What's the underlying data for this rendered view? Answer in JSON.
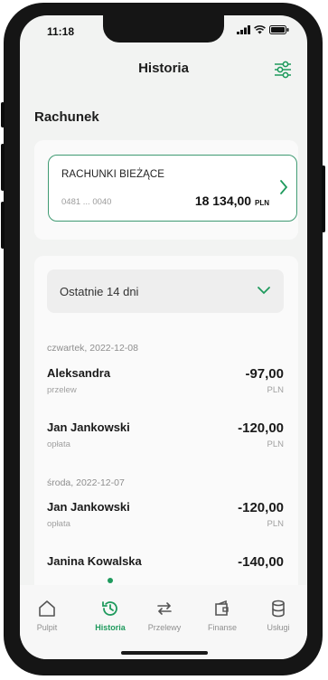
{
  "status_bar": {
    "time": "11:18"
  },
  "header": {
    "title": "Historia",
    "filter_icon": "sliders-icon"
  },
  "section": {
    "label": "Rachunek"
  },
  "account": {
    "name": "RACHUNKI BIEŻĄCE",
    "number": "0481 ... 0040",
    "balance": "18 134,00",
    "currency": "PLN"
  },
  "period": {
    "label": "Ostatnie 14 dni"
  },
  "transactions": {
    "days": [
      {
        "date": "czwartek, 2022-12-08",
        "items": [
          {
            "name": "Aleksandra",
            "type": "przelew",
            "amount": "-97,00",
            "currency": "PLN"
          },
          {
            "name": "Jan Jankowski",
            "type": "opłata",
            "amount": "-120,00",
            "currency": "PLN"
          }
        ]
      },
      {
        "date": "środa, 2022-12-07",
        "items": [
          {
            "name": "Jan Jankowski",
            "type": "opłata",
            "amount": "-120,00",
            "currency": "PLN"
          },
          {
            "name": "Janina Kowalska",
            "type": "",
            "amount": "-140,00",
            "currency": ""
          }
        ]
      }
    ]
  },
  "nav": {
    "items": [
      {
        "label": "Pulpit",
        "icon": "home-icon"
      },
      {
        "label": "Historia",
        "icon": "history-icon",
        "active": true
      },
      {
        "label": "Przelewy",
        "icon": "transfer-icon"
      },
      {
        "label": "Finanse",
        "icon": "wallet-icon"
      },
      {
        "label": "Usługi",
        "icon": "services-icon"
      }
    ]
  },
  "colors": {
    "accent": "#1f9a5d",
    "card_border": "#3f9a72",
    "background": "#f2f3f2"
  }
}
